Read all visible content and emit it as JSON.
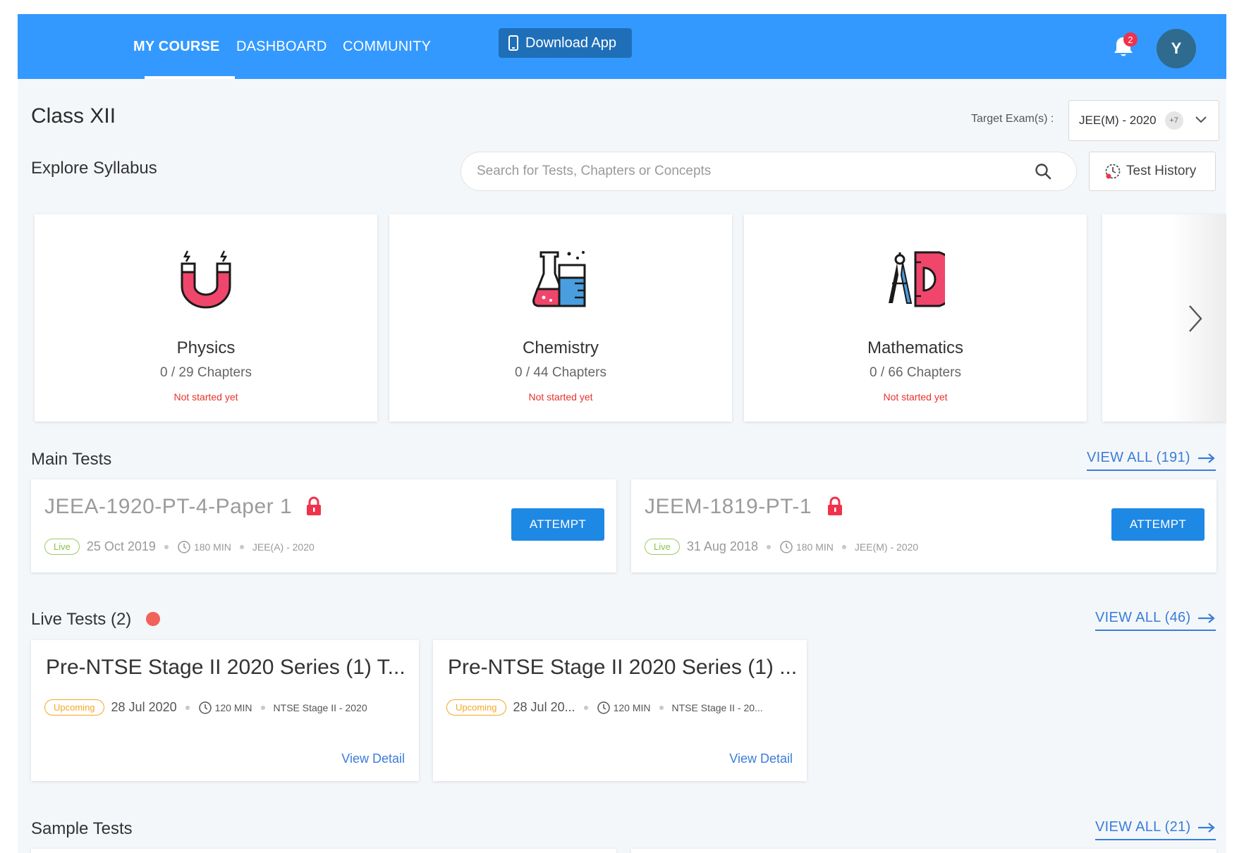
{
  "nav": {
    "my_course": "MY COURSE",
    "dashboard": "DASHBOARD",
    "community": "COMMUNITY",
    "download_app": "Download App",
    "notification_count": "2",
    "avatar_initial": "Y"
  },
  "header": {
    "title": "Class XII",
    "target_label": "Target Exam(s) :",
    "target_value": "JEE(M) - 2020",
    "target_more": "+7"
  },
  "explore": {
    "title": "Explore Syllabus",
    "search_placeholder": "Search for Tests, Chapters or Concepts",
    "test_history": "Test History"
  },
  "subjects": [
    {
      "name": "Physics",
      "chapters": "0 / 29 Chapters",
      "status": "Not started yet",
      "icon": "magnet-icon"
    },
    {
      "name": "Chemistry",
      "chapters": "0 / 44 Chapters",
      "status": "Not started yet",
      "icon": "flask-beaker-icon"
    },
    {
      "name": "Mathematics",
      "chapters": "0 / 66 Chapters",
      "status": "Not started yet",
      "icon": "compass-protractor-icon"
    }
  ],
  "main_tests": {
    "title": "Main Tests",
    "view_all": "VIEW ALL (191)",
    "items": [
      {
        "title": "JEEA-1920-PT-4-Paper 1",
        "badge": "Live",
        "date": "25 Oct 2019",
        "duration": "180 MIN",
        "exam": "JEE(A) - 2020",
        "action": "ATTEMPT"
      },
      {
        "title": "JEEM-1819-PT-1",
        "badge": "Live",
        "date": "31 Aug 2018",
        "duration": "180 MIN",
        "exam": "JEE(M) - 2020",
        "action": "ATTEMPT"
      }
    ]
  },
  "live_tests": {
    "title": "Live Tests (2)",
    "view_all": "VIEW ALL (46)",
    "items": [
      {
        "title": "Pre-NTSE Stage II 2020 Series (1) T...",
        "badge": "Upcoming",
        "date": "28 Jul 2020",
        "duration": "120 MIN",
        "exam": "NTSE Stage II - 2020",
        "link": "View Detail"
      },
      {
        "title": "Pre-NTSE Stage II 2020 Series (1) ...",
        "badge": "Upcoming",
        "date": "28 Jul 20...",
        "duration": "120 MIN",
        "exam": "NTSE Stage II - 20...",
        "link": "View Detail"
      }
    ]
  },
  "sample_tests": {
    "title": "Sample Tests",
    "view_all": "VIEW ALL (21)"
  },
  "colors": {
    "header_blue": "#3399ff",
    "accent_blue": "#1e88e5",
    "link_blue": "#3b7dd8",
    "status_red": "#e8322d",
    "live_green": "#8bc34a",
    "upcoming_orange": "#f5a623"
  }
}
